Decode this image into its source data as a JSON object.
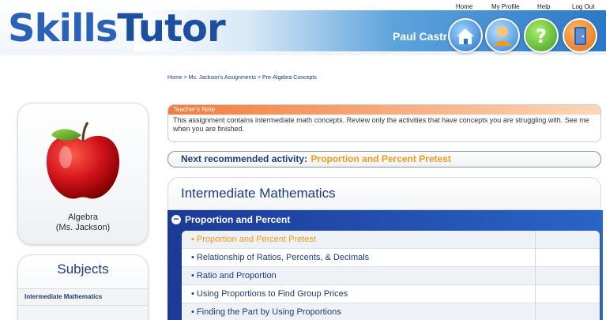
{
  "header": {
    "logo_part1": "Skills",
    "logo_part2": "Tutor",
    "username": "Paul Castro",
    "nav": [
      "Home",
      "My Profile",
      "Help",
      "Log Out"
    ]
  },
  "breadcrumb": "Home > Ms. Jackson's Assignments > Pre-Algebra Concepts",
  "left": {
    "class_name": "Algebra",
    "teacher": "(Ms. Jackson)",
    "subjects_title": "Subjects",
    "subjects": [
      "Intermediate Mathematics"
    ]
  },
  "teacher_note": {
    "title": "Teacher's Note",
    "body": "This assignment contains intermediate math concepts. Review only the activities that have concepts you are struggling with. See me when you are finished."
  },
  "next": {
    "label": "Next recommended activity:",
    "activity": "Proportion and Percent Pretest"
  },
  "course": {
    "title": "Intermediate Mathematics",
    "section": "Proportion and Percent",
    "activities": [
      "• Proportion and Percent Pretest",
      "• Relationship of Ratios, Percents, & Decimals",
      "• Ratio and Proportion",
      "• Using Proportions to Find Group Prices",
      "• Finding the Part by Using Proportions"
    ]
  },
  "colors": {
    "accent_orange": "#f39a1e",
    "navy": "#1c3c78",
    "section_blue": "#1c3a96"
  }
}
